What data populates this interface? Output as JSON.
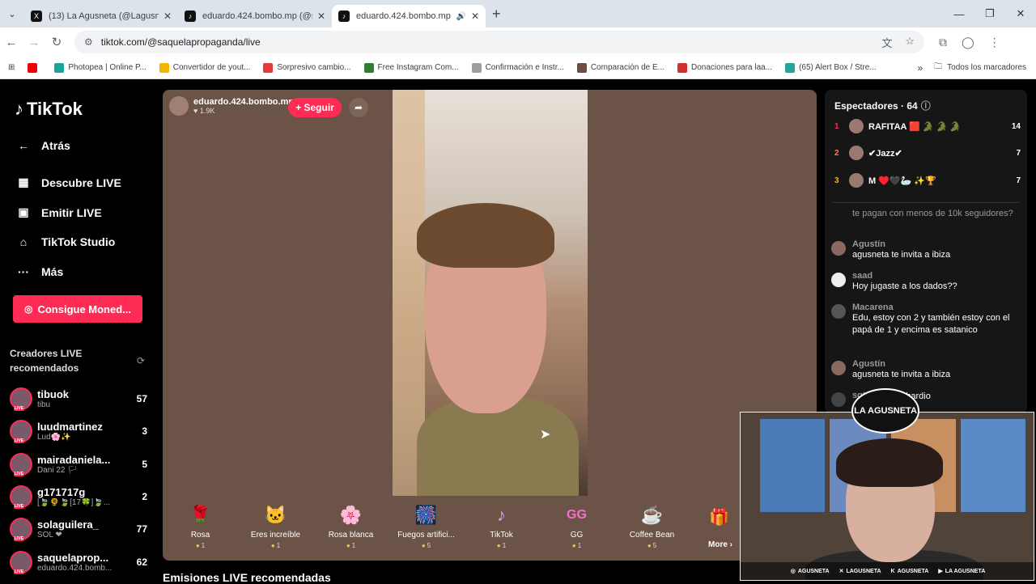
{
  "browser": {
    "tabs": [
      {
        "title": "(13) La Agusneta (@Lagusneta)",
        "favicon": "X"
      },
      {
        "title": "eduardo.424.bombo.mp (@saq",
        "favicon": "♪"
      },
      {
        "title": "eduardo.424.bombo.mp (@",
        "favicon": "♪"
      }
    ],
    "url": "tiktok.com/@saquelapropaganda/live",
    "bookmarks": [
      {
        "label": "Photopea | Online P...",
        "color": "#18a497"
      },
      {
        "label": "Convertidor de yout...",
        "color": "#f5b400"
      },
      {
        "label": "Sorpresivo cambio...",
        "color": "#e53935"
      },
      {
        "label": "Free Instagram Com...",
        "color": "#2e7d32"
      },
      {
        "label": "Confirmación e Instr...",
        "color": "#9e9e9e"
      },
      {
        "label": "Comparación de E...",
        "color": "#6d4c41"
      },
      {
        "label": "Donaciones para laa...",
        "color": "#d32f2f"
      },
      {
        "label": "(65) Alert Box / Stre...",
        "color": "#26a69a"
      }
    ],
    "all_bookmarks": "Todos los marcadores"
  },
  "sidebar": {
    "logo": "TikTok",
    "back": "Atrás",
    "nav": [
      "Descubre LIVE",
      "Emitir LIVE",
      "TikTok Studio",
      "Más"
    ],
    "coins_button": "Consigue Moned...",
    "rec_heading": "Creadores LIVE recomendados",
    "creators": [
      {
        "name": "tibuok",
        "sub": "tibu",
        "count": "57"
      },
      {
        "name": "luudmartinez",
        "sub": "Lud🌸✨",
        "count": "3"
      },
      {
        "name": "mairadaniela...",
        "sub": "Dani 22 🏳",
        "count": "5"
      },
      {
        "name": "g171717g",
        "sub": "[🍃🌻🍃[17🍀]🍃...",
        "count": "2"
      },
      {
        "name": "solaguilera_",
        "sub": "SOL ❤",
        "count": "77"
      },
      {
        "name": "saquelaprop...",
        "sub": "eduardo.424.bomb...",
        "count": "62"
      }
    ]
  },
  "stage": {
    "host_name": "eduardo.424.bombo.mp",
    "host_likes": "♥ 1.9K",
    "follow": "+ Seguir",
    "gifts": [
      {
        "name": "Rosa",
        "price": "1",
        "icon": "🌹"
      },
      {
        "name": "Eres increíble",
        "price": "1",
        "icon": "🐱"
      },
      {
        "name": "Rosa blanca",
        "price": "1",
        "icon": "🌸"
      },
      {
        "name": "Fuegos artifici...",
        "price": "5",
        "icon": "🎆"
      },
      {
        "name": "TikTok",
        "price": "1",
        "icon": "♪"
      },
      {
        "name": "GG",
        "price": "1",
        "icon": "GG"
      },
      {
        "name": "Coffee Bean",
        "price": "5",
        "icon": "☕"
      }
    ],
    "more": "More ›",
    "below_heading": "Emisiones LIVE recomendadas"
  },
  "chat": {
    "heading": "Espectadores · 64",
    "viewers": [
      {
        "rank": "1",
        "name": "RAFITAA 🟥 🐊 🐊 🐊",
        "score": "14"
      },
      {
        "rank": "2",
        "name": "✔Jazz✔",
        "score": "7"
      },
      {
        "rank": "3",
        "name": "M ♥️🖤🦢 ✨🏆",
        "score": "7"
      }
    ],
    "messages": [
      {
        "user": "",
        "text": "te pagan con menos de 10k seguidores?"
      },
      {
        "user": "Agustín",
        "text": "agusneta te invita a ibiza"
      },
      {
        "user": "saad",
        "text": "Hoy jugaste a los dados??"
      },
      {
        "user": "Macarena",
        "text": "Edu, estoy con 2 y también estoy con el papá de 1 y encima es satanico"
      },
      {
        "user": "Agustín",
        "text": "agusneta te invita a ibiza"
      },
      {
        "user": "sgtvt",
        "text": "bardio"
      }
    ]
  },
  "overlay": {
    "brand": "LA AGUSNETA",
    "socials": [
      "AGUSNETA",
      "LAGUSNETA",
      "AGUSNETA",
      "LA AGUSNETA"
    ]
  }
}
